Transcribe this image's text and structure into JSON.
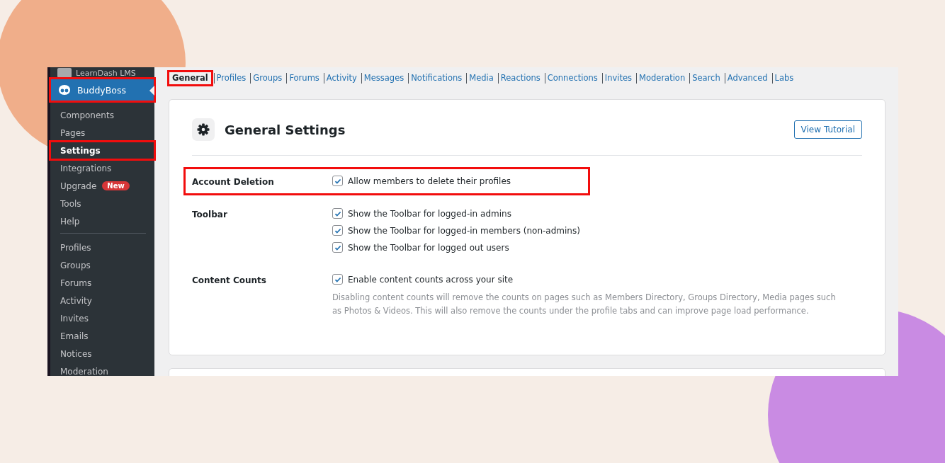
{
  "sidebar": {
    "top_item": "LearnDash LMS",
    "parent": {
      "label": "BuddyBoss",
      "selected": true,
      "highlighted": true
    },
    "items": [
      {
        "label": "Components",
        "selected": false,
        "highlighted": false
      },
      {
        "label": "Pages",
        "selected": false,
        "highlighted": false
      },
      {
        "label": "Settings",
        "selected": true,
        "highlighted": true
      },
      {
        "label": "Integrations",
        "selected": false,
        "highlighted": false
      },
      {
        "label": "Upgrade",
        "selected": false,
        "highlighted": false,
        "badge": "New"
      },
      {
        "label": "Tools",
        "selected": false,
        "highlighted": false
      },
      {
        "label": "Help",
        "selected": false,
        "highlighted": false
      }
    ],
    "items_2": [
      {
        "label": "Profiles"
      },
      {
        "label": "Groups"
      },
      {
        "label": "Forums"
      },
      {
        "label": "Activity"
      },
      {
        "label": "Invites"
      },
      {
        "label": "Emails"
      },
      {
        "label": "Notices"
      },
      {
        "label": "Moderation"
      }
    ]
  },
  "tabs": [
    {
      "label": "General",
      "selected": true,
      "highlighted": true
    },
    {
      "label": "Profiles",
      "selected": false,
      "highlighted": false
    },
    {
      "label": "Groups",
      "selected": false,
      "highlighted": false
    },
    {
      "label": "Forums",
      "selected": false,
      "highlighted": false
    },
    {
      "label": "Activity",
      "selected": false,
      "highlighted": false
    },
    {
      "label": "Messages",
      "selected": false,
      "highlighted": false
    },
    {
      "label": "Notifications",
      "selected": false,
      "highlighted": false
    },
    {
      "label": "Media",
      "selected": false,
      "highlighted": false
    },
    {
      "label": "Reactions",
      "selected": false,
      "highlighted": false
    },
    {
      "label": "Connections",
      "selected": false,
      "highlighted": false
    },
    {
      "label": "Invites",
      "selected": false,
      "highlighted": false
    },
    {
      "label": "Moderation",
      "selected": false,
      "highlighted": false
    },
    {
      "label": "Search",
      "selected": false,
      "highlighted": false
    },
    {
      "label": "Advanced",
      "selected": false,
      "highlighted": false
    },
    {
      "label": "Labs",
      "selected": false,
      "highlighted": false
    }
  ],
  "card": {
    "title": "General Settings",
    "button": "View Tutorial",
    "settings": [
      {
        "label": "Account Deletion",
        "highlighted": true,
        "options": [
          {
            "label": "Allow members to delete their profiles",
            "checked": true
          }
        ]
      },
      {
        "label": "Toolbar",
        "highlighted": false,
        "options": [
          {
            "label": "Show the Toolbar for logged-in admins",
            "checked": true
          },
          {
            "label": "Show the Toolbar for logged-in members (non-admins)",
            "checked": true
          },
          {
            "label": "Show the Toolbar for logged out users",
            "checked": true
          }
        ]
      },
      {
        "label": "Content Counts",
        "highlighted": false,
        "options": [
          {
            "label": "Enable content counts across your site",
            "checked": true
          }
        ],
        "description": "Disabling content counts will remove the counts on pages such as Members Directory, Groups Directory, Media pages such as Photos & Videos. This will also remove the counts under the profile tabs and can improve page load performance."
      }
    ]
  }
}
